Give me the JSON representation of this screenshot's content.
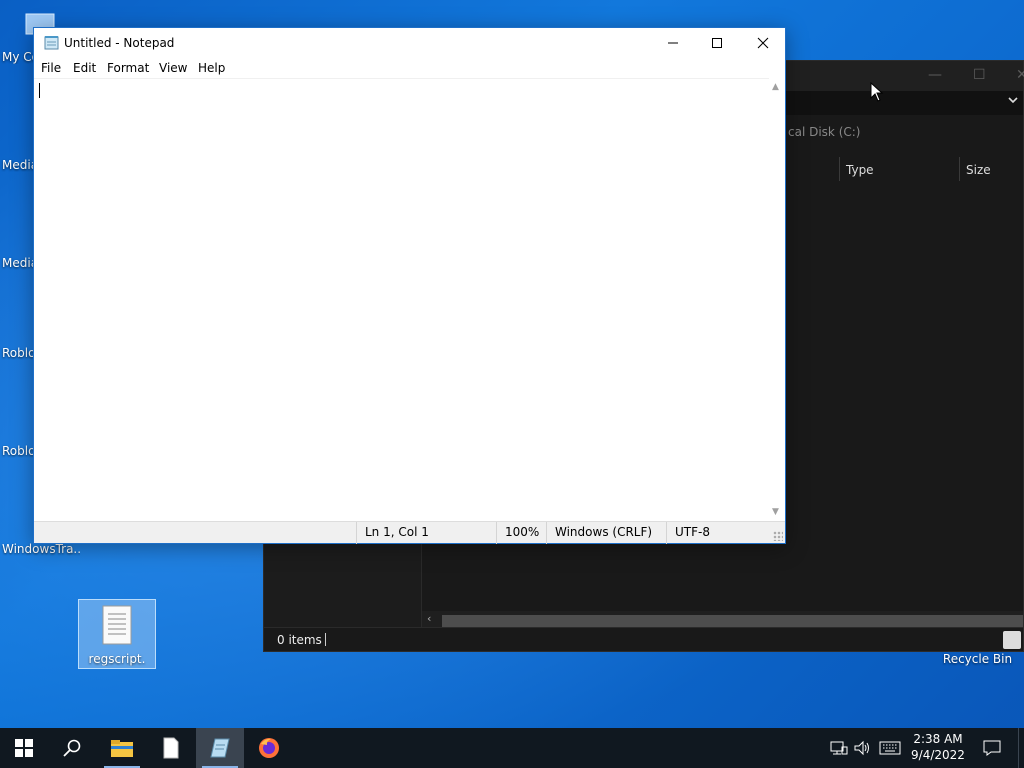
{
  "desktop": {
    "icons": [
      {
        "label": "My Co"
      },
      {
        "label": "Media"
      },
      {
        "label": "Media"
      },
      {
        "label": "Roblo"
      },
      {
        "label": "Roblo"
      },
      {
        "label": "WindowsTra..."
      },
      {
        "label": "regscript."
      },
      {
        "label": "Recycle Bin"
      }
    ]
  },
  "explorer": {
    "path_fragment": "cal Disk (C:)",
    "columns": [
      "Type",
      "Size"
    ],
    "status": "0 items"
  },
  "notepad": {
    "title": "Untitled - Notepad",
    "menu": [
      "File",
      "Edit",
      "Format",
      "View",
      "Help"
    ],
    "content": "",
    "status": {
      "position": "Ln 1, Col 1",
      "zoom": "100%",
      "line_endings": "Windows (CRLF)",
      "encoding": "UTF-8"
    }
  },
  "taskbar": {
    "time": "2:38 AM",
    "date": "9/4/2022"
  },
  "colors": {
    "accent": "#0a5fc4",
    "taskbar": "#101820",
    "explorer_bg": "#191919"
  }
}
